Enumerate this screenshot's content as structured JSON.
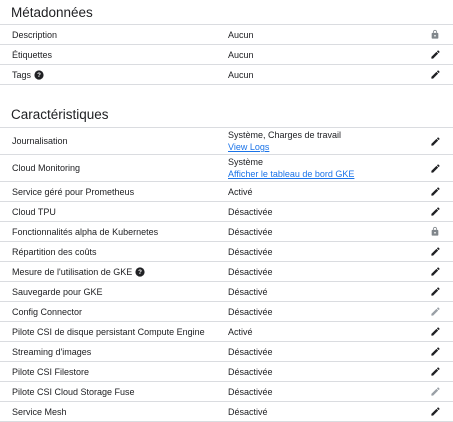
{
  "metadata": {
    "title": "Métadonnées",
    "rows": [
      {
        "label": "Description",
        "value": "Aucun",
        "icon": "lock-icon"
      },
      {
        "label": "Étiquettes",
        "value": "Aucun",
        "icon": "edit-icon"
      },
      {
        "label": "Tags",
        "value": "Aucun",
        "icon": "edit-icon",
        "help": true
      }
    ]
  },
  "features": {
    "title": "Caractéristiques",
    "rows": [
      {
        "label": "Journalisation",
        "value": "Système, Charges de travail",
        "link": "View Logs",
        "icon": "edit-icon"
      },
      {
        "label": "Cloud Monitoring",
        "value": "Système",
        "link": "Afficher le tableau de bord GKE",
        "icon": "edit-icon"
      },
      {
        "label": "Service géré pour Prometheus",
        "value": "Activé",
        "icon": "edit-icon"
      },
      {
        "label": "Cloud TPU",
        "value": "Désactivée",
        "icon": "edit-icon"
      },
      {
        "label": "Fonctionnalités alpha de Kubernetes",
        "value": "Désactivée",
        "icon": "lock-icon"
      },
      {
        "label": "Répartition des coûts",
        "value": "Désactivée",
        "icon": "edit-icon"
      },
      {
        "label": "Mesure de l'utilisation de GKE",
        "value": "Désactivée",
        "icon": "edit-icon",
        "help": true
      },
      {
        "label": "Sauvegarde pour GKE",
        "value": "Désactivé",
        "icon": "edit-icon"
      },
      {
        "label": "Config Connector",
        "value": "Désactivée",
        "icon": "edit-disabled-icon"
      },
      {
        "label": "Pilote CSI de disque persistant Compute Engine",
        "value": "Activé",
        "icon": "edit-icon"
      },
      {
        "label": "Streaming d'images",
        "value": "Désactivée",
        "icon": "edit-icon"
      },
      {
        "label": "Pilote CSI Filestore",
        "value": "Désactivée",
        "icon": "edit-icon"
      },
      {
        "label": "Pilote CSI Cloud Storage Fuse",
        "value": "Désactivée",
        "icon": "edit-disabled-icon"
      },
      {
        "label": "Service Mesh",
        "value": "Désactivé",
        "icon": "edit-icon"
      }
    ]
  },
  "colors": {
    "text": "#202124",
    "link": "#1a73e8",
    "divider": "#dadce0",
    "icon": "#202124",
    "icon_muted": "#9aa0a6"
  }
}
